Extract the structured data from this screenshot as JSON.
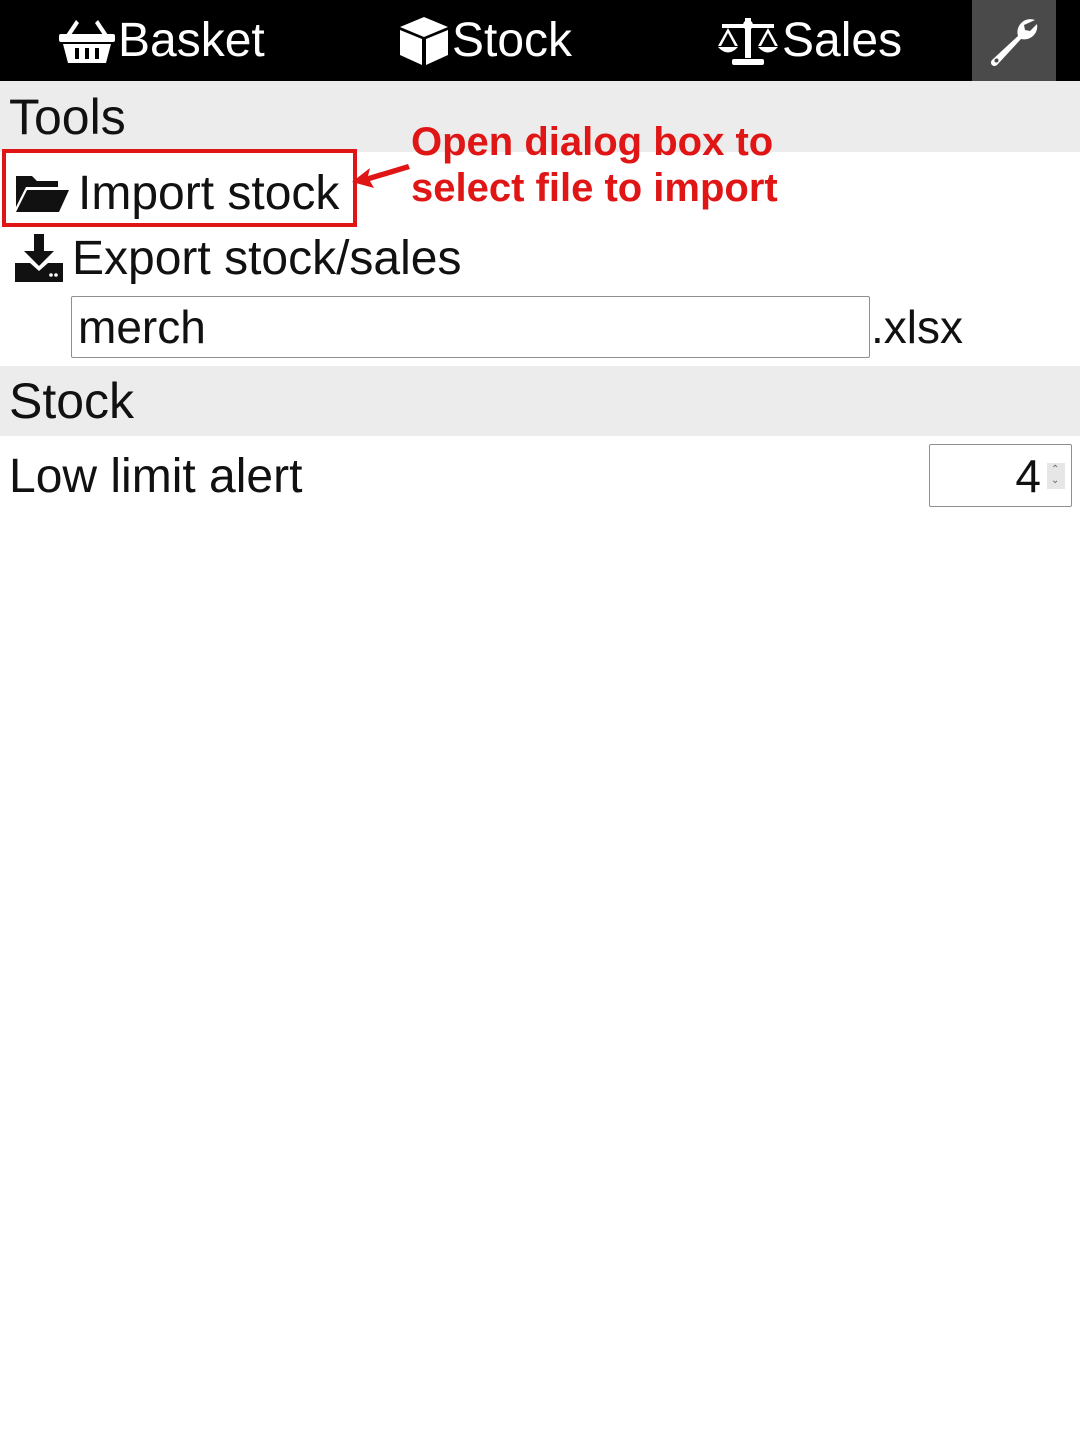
{
  "nav": {
    "tabs": [
      {
        "label": "Basket",
        "icon": "basket-icon"
      },
      {
        "label": "Stock",
        "icon": "box-icon"
      },
      {
        "label": "Sales",
        "icon": "scale-icon"
      }
    ],
    "settings_icon": "wrench-icon",
    "active_tab": "settings"
  },
  "tools": {
    "header": "Tools",
    "import_label": "Import stock",
    "import_icon": "folder-open-icon",
    "export_label": "Export stock/sales",
    "export_icon": "download-icon",
    "filename_value": "merch",
    "extension": ".xlsx"
  },
  "stock": {
    "header": "Stock",
    "low_limit_label": "Low limit alert",
    "low_limit_value": "4"
  },
  "annotation": {
    "text_line1": "Open dialog box to",
    "text_line2": "select file to import",
    "color": "#e01616"
  },
  "colors": {
    "nav_bg": "#000000",
    "nav_active_bg": "#4a4a4a",
    "section_header_bg": "#ececec"
  }
}
